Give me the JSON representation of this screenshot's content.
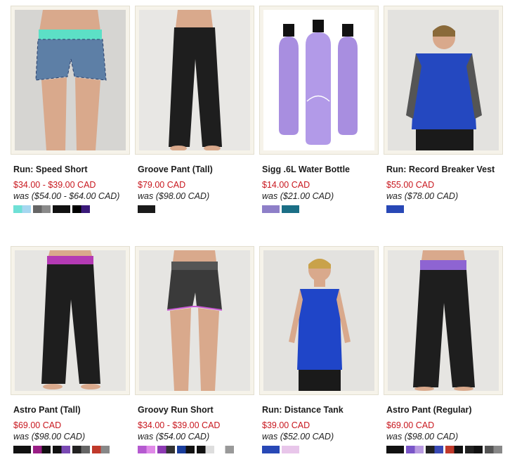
{
  "products": [
    {
      "name": "Run: Speed Short",
      "price": "$34.00 - $39.00 CAD",
      "was": "was ($54.00 - $64.00 CAD)",
      "swatches": [
        [
          "#6fe0d6",
          "#a6d7f0"
        ],
        [
          "#666",
          "#8a8a8a"
        ],
        [
          "#111",
          "#111"
        ],
        [
          "#000",
          "#3b1a7a"
        ]
      ]
    },
    {
      "name": "Groove Pant (Tall)",
      "price": "$79.00 CAD",
      "was": "was ($98.00 CAD)",
      "swatches": [
        [
          "#1a1a1a",
          "#1a1a1a"
        ]
      ]
    },
    {
      "name": "Sigg .6L Water Bottle",
      "price": "$14.00 CAD",
      "was": "was ($21.00 CAD)",
      "swatches": [
        [
          "#8e7fc8",
          "#8e7fc8"
        ],
        [
          "#1b6f86",
          "#1b6f86"
        ]
      ]
    },
    {
      "name": "Run: Record Breaker Vest",
      "price": "$55.00 CAD",
      "was": "was ($78.00 CAD)",
      "swatches": [
        [
          "#2848b6",
          "#2848b6"
        ]
      ]
    },
    {
      "name": "Astro Pant (Tall)",
      "price": "$69.00 CAD",
      "was": "was ($98.00 CAD)",
      "swatches": [
        [
          "#111",
          "#111"
        ],
        [
          "#9a1f86",
          "#111"
        ],
        [
          "#111",
          "#7a4ab4"
        ],
        [
          "#222",
          "#666"
        ],
        [
          "#c0392b",
          "#888"
        ]
      ]
    },
    {
      "name": "Groovy Run Short",
      "price": "$34.00 - $39.00 CAD",
      "was": "was ($54.00 CAD)",
      "swatches": [
        [
          "#b55ad0",
          "#e08ae8"
        ],
        [
          "#8e3bb4",
          "#333"
        ],
        [
          "#1a3d9c",
          "#111"
        ],
        [
          "#111",
          "#ddd"
        ],
        [
          "#fff",
          "#999"
        ]
      ]
    },
    {
      "name": "Run: Distance Tank",
      "price": "$39.00 CAD",
      "was": "was ($52.00 CAD)",
      "swatches": [
        [
          "#2848b6",
          "#2848b6"
        ],
        [
          "#e8c6ea",
          "#e8c6ea"
        ]
      ]
    },
    {
      "name": "Astro Pant (Regular)",
      "price": "$69.00 CAD",
      "was": "was ($98.00 CAD)",
      "swatches": [
        [
          "#111",
          "#111"
        ],
        [
          "#7a56c8",
          "#b89ae0"
        ],
        [
          "#222",
          "#3a4ab6"
        ],
        [
          "#c0392b",
          "#111"
        ],
        [
          "#222",
          "#111"
        ],
        [
          "#555",
          "#888"
        ]
      ]
    }
  ]
}
